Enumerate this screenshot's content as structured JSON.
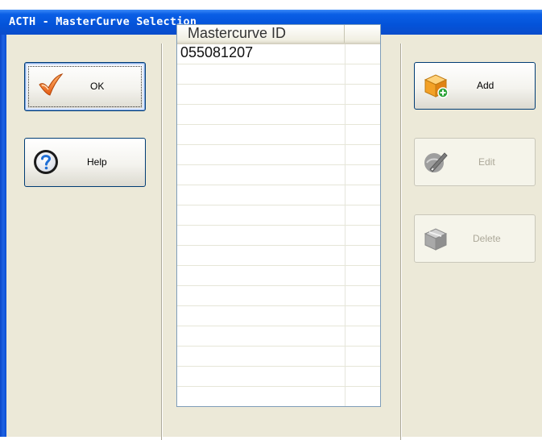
{
  "window": {
    "title": "ACTH - MasterCurve Selection"
  },
  "left_buttons": {
    "ok": {
      "label": "OK",
      "icon": "checkmark-icon"
    },
    "help": {
      "label": "Help",
      "icon": "help-icon"
    }
  },
  "right_buttons": {
    "add": {
      "label": "Add",
      "icon": "add-box-icon",
      "enabled": true
    },
    "edit": {
      "label": "Edit",
      "icon": "edit-icon",
      "enabled": false
    },
    "delete": {
      "label": "Delete",
      "icon": "delete-box-icon",
      "enabled": false
    }
  },
  "list": {
    "column_header": "Mastercurve ID",
    "rows": [
      "055081207",
      "",
      "",
      "",
      "",
      "",
      "",
      "",
      "",
      "",
      "",
      "",
      "",
      "",
      "",
      "",
      "",
      ""
    ]
  },
  "colors": {
    "title_bar": "#0453d9",
    "client_bg": "#ece9d8",
    "button_border": "#003c74",
    "disabled_text": "#aca899"
  }
}
